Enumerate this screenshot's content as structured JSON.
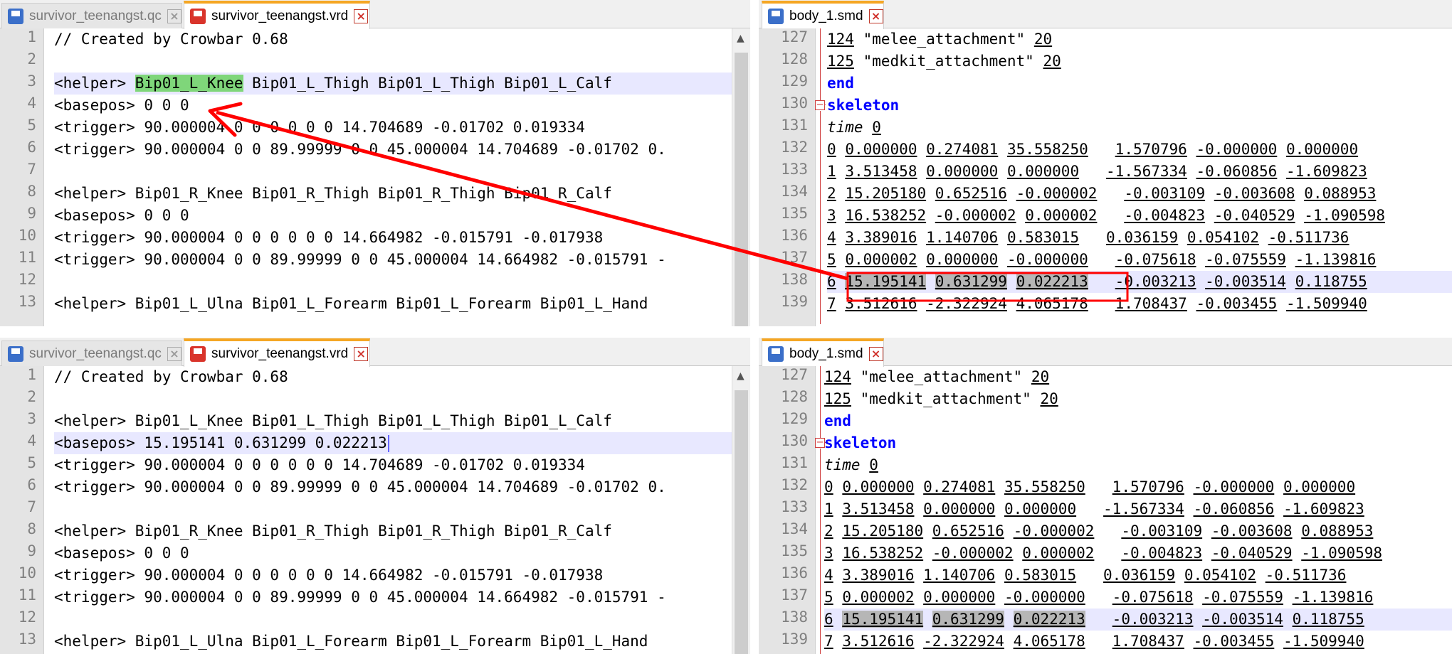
{
  "top": {
    "left_tabs": [
      {
        "label": "survivor_teenangst.qc",
        "state": "inactive"
      },
      {
        "label": "survivor_teenangst.vrd",
        "state": "active"
      }
    ],
    "right_tab": {
      "label": "body_1.smd"
    },
    "vrd_line_numbers": [
      "1",
      "2",
      "3",
      "4",
      "5",
      "6",
      "7",
      "8",
      "9",
      "10",
      "11",
      "12",
      "13"
    ],
    "vrd": {
      "l1": "// Created by Crowbar 0.68",
      "l3_pre": "<helper> ",
      "l3_hl": "Bip01_L_Knee",
      "l3_post": " Bip01_L_Thigh Bip01_L_Thigh Bip01_L_Calf",
      "l4": "<basepos> 0 0 0",
      "l5": "<trigger> 90.000004 0 0 0 0 0 0 14.704689 -0.01702 0.019334",
      "l6": "<trigger> 90.000004 0 0 89.99999 0 0 45.000004 14.704689 -0.01702 0.",
      "l8": "<helper> Bip01_R_Knee Bip01_R_Thigh Bip01_R_Thigh Bip01_R_Calf",
      "l9": "<basepos> 0 0 0",
      "l10": "<trigger> 90.000004 0 0 0 0 0 0 14.664982 -0.015791 -0.017938",
      "l11": "<trigger> 90.000004 0 0 89.99999 0 0 45.000004 14.664982 -0.015791 -",
      "l13": "<helper> Bip01_L_Ulna Bip01_L_Forearm Bip01_L_Forearm Bip01_L_Hand"
    }
  },
  "bottom": {
    "left_tabs": [
      {
        "label": "survivor_teenangst.qc",
        "state": "inactive"
      },
      {
        "label": "survivor_teenangst.vrd",
        "state": "active"
      }
    ],
    "right_tab": {
      "label": "body_1.smd"
    },
    "vrd": {
      "l1": "// Created by Crowbar 0.68",
      "l3": "<helper> Bip01_L_Knee Bip01_L_Thigh Bip01_L_Thigh Bip01_L_Calf",
      "l4": "<basepos> 15.195141 0.631299 0.022213",
      "l5": "<trigger> 90.000004 0 0 0 0 0 0 14.704689 -0.01702 0.019334",
      "l6": "<trigger> 90.000004 0 0 89.99999 0 0 45.000004 14.704689 -0.01702 0.",
      "l8": "<helper> Bip01_R_Knee Bip01_R_Thigh Bip01_R_Thigh Bip01_R_Calf",
      "l9": "<basepos> 0 0 0",
      "l10": "<trigger> 90.000004 0 0 0 0 0 0 14.664982 -0.015791 -0.017938",
      "l11": "<trigger> 90.000004 0 0 89.99999 0 0 45.000004 14.664982 -0.015791 -",
      "l13": "<helper> Bip01_L_Ulna Bip01_L_Forearm Bip01_L_Forearm Bip01_L_Hand"
    }
  },
  "smd": {
    "line_numbers": [
      "127",
      "128",
      "129",
      "130",
      "131",
      "132",
      "133",
      "134",
      "135",
      "136",
      "137",
      "138",
      "139"
    ],
    "l127": {
      "num": "124",
      "str": "\"melee_attachment\"",
      "val": "20"
    },
    "l128": {
      "num": "125",
      "str": "\"medkit_attachment\"",
      "val": "20"
    },
    "l129": "end",
    "l130": "skeleton",
    "l131": {
      "kw": "time",
      "val": "0"
    },
    "rows": [
      {
        "id": "0",
        "a": "0.000000",
        "b": "0.274081",
        "c": "35.558250",
        "d": "1.570796",
        "e": "-0.000000",
        "f": "0.000000"
      },
      {
        "id": "1",
        "a": "3.513458",
        "b": "0.000000",
        "c": "0.000000",
        "d": "-1.567334",
        "e": "-0.060856",
        "f": "-1.609823"
      },
      {
        "id": "2",
        "a": "15.205180",
        "b": "0.652516",
        "c": "-0.000002",
        "d": "-0.003109",
        "e": "-0.003608",
        "f": "0.088953"
      },
      {
        "id": "3",
        "a": "16.538252",
        "b": "-0.000002",
        "c": "0.000002",
        "d": "-0.004823",
        "e": "-0.040529",
        "f": "-1.090598"
      },
      {
        "id": "4",
        "a": "3.389016",
        "b": "1.140706",
        "c": "0.583015",
        "d": "0.036159",
        "e": "0.054102",
        "f": "-0.511736"
      },
      {
        "id": "5",
        "a": "0.000002",
        "b": "0.000000",
        "c": "-0.000000",
        "d": "-0.075618",
        "e": "-0.075559",
        "f": "-1.139816"
      },
      {
        "id": "6",
        "a": "15.195141",
        "b": "0.631299",
        "c": "0.022213",
        "d": "-0.003213",
        "e": "-0.003514",
        "f": "0.118755"
      },
      {
        "id": "7",
        "a": "3.512616",
        "b": "-2.322924",
        "c": "4.065178",
        "d": "1.708437",
        "e": "-0.003455",
        "f": "-1.509940"
      }
    ]
  },
  "colors": {
    "annotation": "#ff0000",
    "keyword": "#0000ff",
    "highlight": "#7fd67a",
    "selection": "#b6b6b6",
    "active_tab_accent": "#f5a623"
  }
}
